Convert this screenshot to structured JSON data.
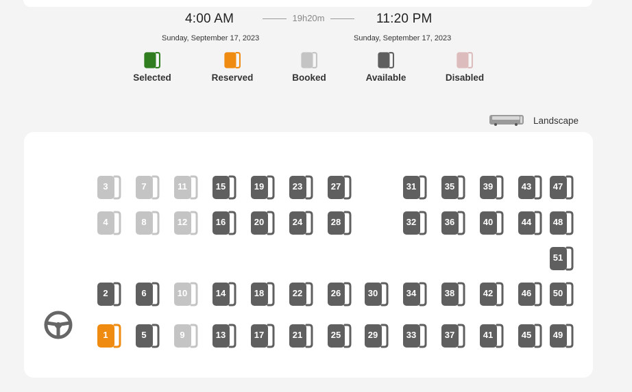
{
  "trip": {
    "departure_time": "4:00 AM",
    "departure_date": "Sunday, September 17, 2023",
    "duration": "19h20m",
    "arrival_time": "11:20 PM",
    "arrival_date": "Sunday, September 17, 2023"
  },
  "legend": [
    {
      "label": "Selected",
      "color": "#2f7d1f"
    },
    {
      "label": "Reserved",
      "color": "#f08b12"
    },
    {
      "label": "Booked",
      "color": "#c4c4c4"
    },
    {
      "label": "Available",
      "color": "#5f5f5f"
    },
    {
      "label": "Disabled",
      "color": "#dcbcbc"
    }
  ],
  "layout_toggle": {
    "label": "Landscape",
    "icon": "bus-icon"
  },
  "steering_icon": "steering-wheel-icon",
  "status_colors": {
    "selected": "#2f7d1f",
    "reserved": "#f08b12",
    "booked": "#c4c4c4",
    "available": "#5f5f5f",
    "disabled": "#dcbcbc"
  },
  "seats": [
    {
      "number": "3",
      "status": "booked"
    },
    {
      "number": "7",
      "status": "booked"
    },
    {
      "number": "11",
      "status": "booked"
    },
    {
      "number": "15",
      "status": "available"
    },
    {
      "number": "19",
      "status": "available"
    },
    {
      "number": "23",
      "status": "available"
    },
    {
      "number": "27",
      "status": "available"
    },
    {
      "number": "31",
      "status": "available"
    },
    {
      "number": "35",
      "status": "available"
    },
    {
      "number": "39",
      "status": "available"
    },
    {
      "number": "43",
      "status": "available"
    },
    {
      "number": "47",
      "status": "available"
    },
    {
      "number": "4",
      "status": "booked"
    },
    {
      "number": "8",
      "status": "booked"
    },
    {
      "number": "12",
      "status": "booked"
    },
    {
      "number": "16",
      "status": "available"
    },
    {
      "number": "20",
      "status": "available"
    },
    {
      "number": "24",
      "status": "available"
    },
    {
      "number": "28",
      "status": "available"
    },
    {
      "number": "32",
      "status": "available"
    },
    {
      "number": "36",
      "status": "available"
    },
    {
      "number": "40",
      "status": "available"
    },
    {
      "number": "44",
      "status": "available"
    },
    {
      "number": "48",
      "status": "available"
    },
    {
      "number": "51",
      "status": "available"
    },
    {
      "number": "2",
      "status": "available"
    },
    {
      "number": "6",
      "status": "available"
    },
    {
      "number": "10",
      "status": "booked"
    },
    {
      "number": "14",
      "status": "available"
    },
    {
      "number": "18",
      "status": "available"
    },
    {
      "number": "22",
      "status": "available"
    },
    {
      "number": "26",
      "status": "available"
    },
    {
      "number": "30",
      "status": "available"
    },
    {
      "number": "34",
      "status": "available"
    },
    {
      "number": "38",
      "status": "available"
    },
    {
      "number": "42",
      "status": "available"
    },
    {
      "number": "46",
      "status": "available"
    },
    {
      "number": "50",
      "status": "available"
    },
    {
      "number": "1",
      "status": "reserved"
    },
    {
      "number": "5",
      "status": "available"
    },
    {
      "number": "9",
      "status": "booked"
    },
    {
      "number": "13",
      "status": "available"
    },
    {
      "number": "17",
      "status": "available"
    },
    {
      "number": "21",
      "status": "available"
    },
    {
      "number": "25",
      "status": "available"
    },
    {
      "number": "29",
      "status": "available"
    },
    {
      "number": "33",
      "status": "available"
    },
    {
      "number": "37",
      "status": "available"
    },
    {
      "number": "41",
      "status": "available"
    },
    {
      "number": "45",
      "status": "available"
    },
    {
      "number": "49",
      "status": "available"
    }
  ]
}
